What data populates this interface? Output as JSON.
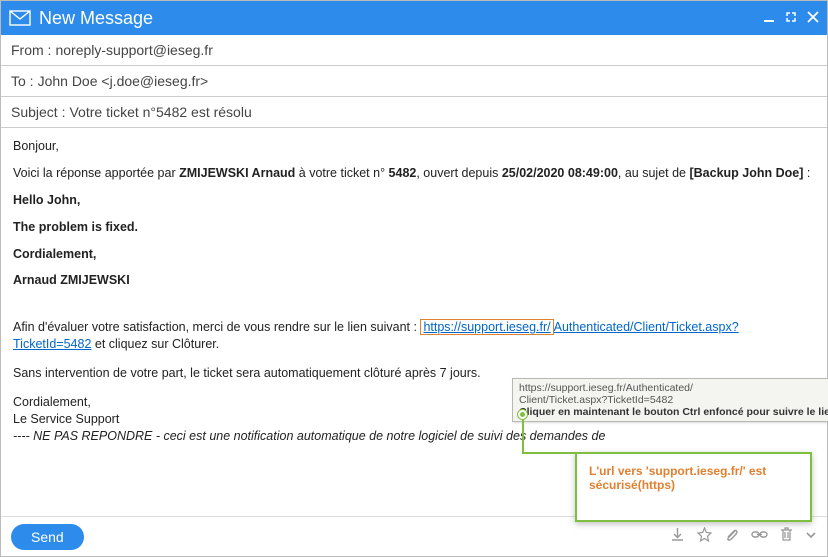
{
  "window": {
    "title": "New Message"
  },
  "header": {
    "from_label": "From :",
    "from_value": "noreply-support@ieseg.fr",
    "to_label": "To :",
    "to_value": "John Doe <j.doe@ieseg.fr>",
    "subject_label": "Subject :",
    "subject_value": "Votre ticket n°5482 est résolu"
  },
  "body": {
    "greeting": "Bonjour,",
    "intro_pre": "Voici la réponse apportée par ",
    "intro_agent": "ZMIJEWSKI Arnaud",
    "intro_mid1": " à votre ticket n° ",
    "intro_ticket": "5482",
    "intro_mid2": ", ouvert depuis ",
    "intro_date": "25/02/2020 08:49:00",
    "intro_mid3": ", au sujet de ",
    "intro_subject": "[Backup John Doe]",
    "intro_end": " :",
    "hello": "Hello John,",
    "fixed": "The problem is fixed.",
    "cordialement": "Cordialement,",
    "signature": "Arnaud ZMIJEWSKI",
    "satisf_pre": "Afin d'évaluer votre satisfaction, merci de vous rendre sur le lien suivant : ",
    "link_boxed": "https://support.ieseg.fr/",
    "link_rest": "Authenticated/Client/Ticket.aspx?TicketId=5482",
    "satisf_close": " et cliquez sur Clôturer.",
    "auto_close": "Sans intervention de votre part, le ticket sera automatiquement clôturé après 7 jours.",
    "footer_cord": "Cordialement,",
    "footer_service": "Le Service Support",
    "footer_disclaimer": "---- NE PAS REPONDRE - ceci est une notification automatique de notre logiciel de suivi des demandes de "
  },
  "tooltip": {
    "line1": "https://support.ieseg.fr/Authenticated/",
    "line2": "Client/Ticket.aspx?TicketId=5482",
    "line3": "Cliquer en maintenant le bouton Ctrl enfoncé pour suivre le lien"
  },
  "callout": {
    "text": "L'url vers 'support.ieseg.fr/' est sécurisé(https)"
  },
  "footer": {
    "send": "Send"
  }
}
